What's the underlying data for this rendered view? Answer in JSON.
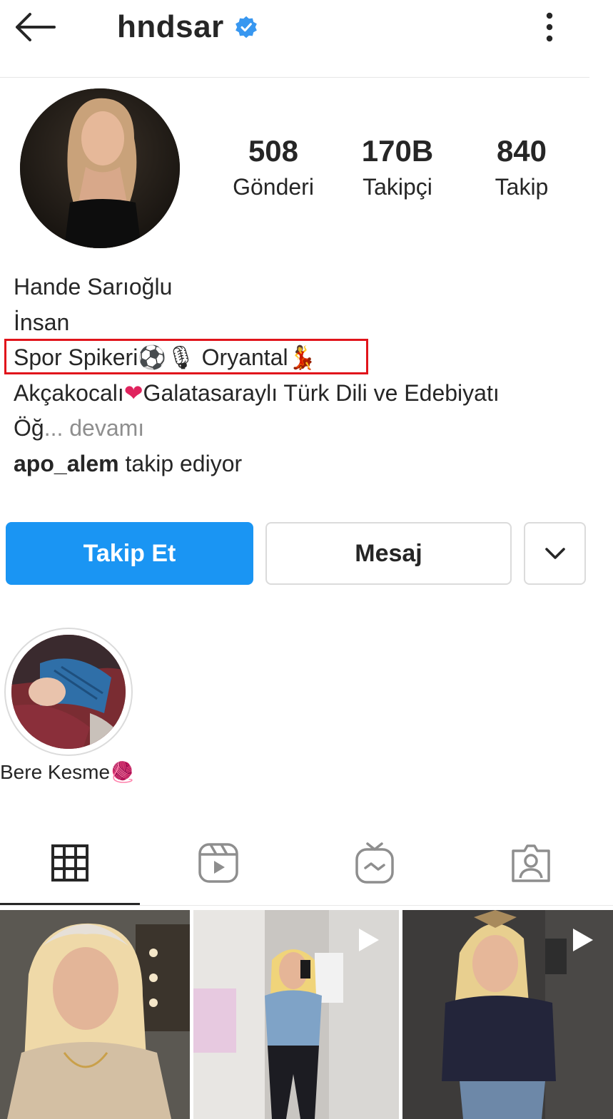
{
  "header": {
    "username": "hndsar",
    "verified": true,
    "back_icon": "arrow-left-icon",
    "more_icon": "three-dots-vertical-icon"
  },
  "stats": [
    {
      "value": "508",
      "label": "Gönderi"
    },
    {
      "value": "170B",
      "label": "Takipçi"
    },
    {
      "value": "840",
      "label": "Takip"
    }
  ],
  "bio": {
    "name": "Hande Sarıoğlu",
    "category": "İnsan",
    "line3_text1": "Spor Spikeri",
    "line3_emoji1": "⚽🎙",
    "line3_text2": " Oryantal",
    "line3_emoji2": "💃",
    "line4_text1": "Akçakocalı",
    "line4_emoji": "❤",
    "line4_text2": "Galatasaraylı Türk Dili ve Edebiyatı",
    "line5_text": "Öğ",
    "line5_more": "... devamı",
    "followed_by_user": "apo_alem",
    "followed_by_suffix": " takip ediyor"
  },
  "actions": {
    "follow_label": "Takip Et",
    "message_label": "Mesaj",
    "more_icon": "chevron-down-icon"
  },
  "highlights": [
    {
      "label": "Bere Kesme",
      "emoji": "🧶"
    }
  ],
  "tabs": [
    {
      "icon": "grid-icon",
      "active": true
    },
    {
      "icon": "reels-icon",
      "active": false
    },
    {
      "icon": "igtv-icon",
      "active": false
    },
    {
      "icon": "tagged-icon",
      "active": false
    }
  ],
  "colors": {
    "accent": "#1a95f3",
    "verified": "#3897f0",
    "highlight_border": "#e1141b",
    "muted": "#8e8e8e"
  }
}
